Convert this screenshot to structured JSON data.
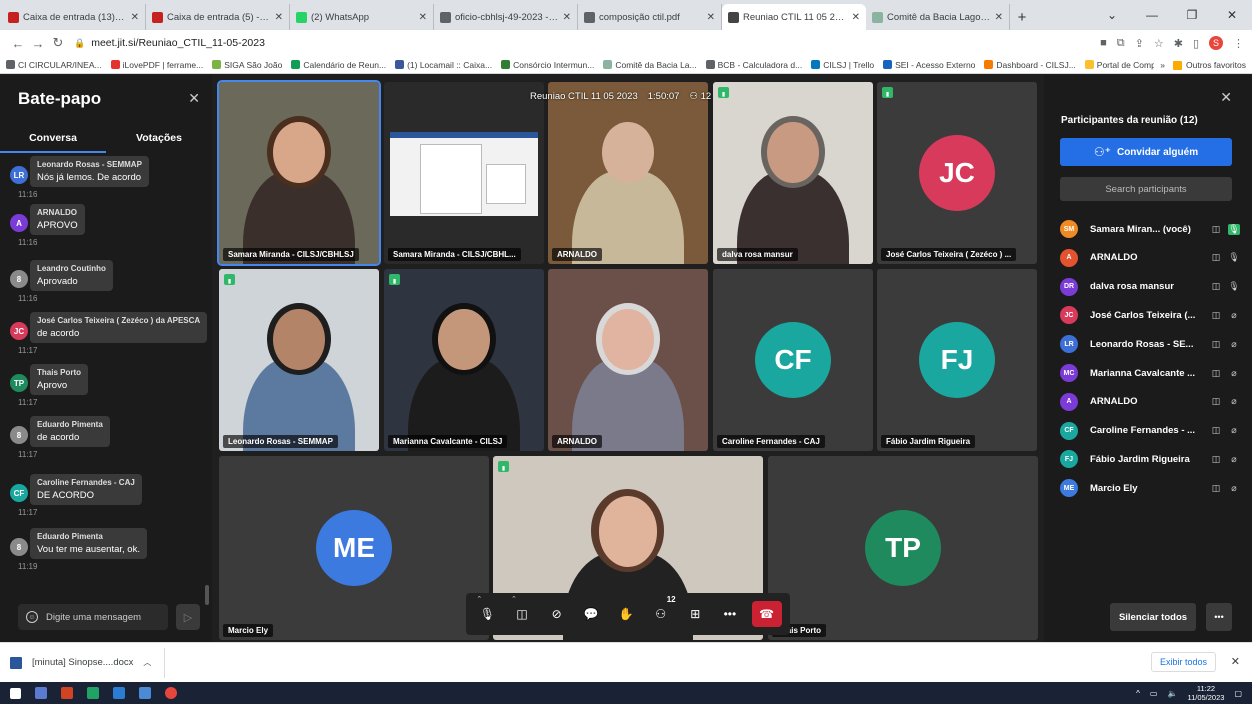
{
  "browser": {
    "tabs": [
      {
        "title": "Caixa de entrada (13) - samaran",
        "color": "#c5221f"
      },
      {
        "title": "Caixa de entrada (5) - cbhlagos",
        "color": "#c5221f"
      },
      {
        "title": "(2) WhatsApp",
        "color": "#25d366"
      },
      {
        "title": "oficio-cbhlsj-49-2023 - convocaç",
        "color": "#5f6368"
      },
      {
        "title": "composição ctil.pdf",
        "color": "#5f6368"
      },
      {
        "title": "Reuniao CTIL 11 05 2023 |",
        "color": "#444444",
        "active": true
      },
      {
        "title": "Comitê da Bacia Lagos São João",
        "color": "#8ab4a0"
      }
    ],
    "new_tab": "+",
    "url": "meet.jit.si/Reuniao_CTIL_11-05-2023",
    "bookmarks": [
      {
        "label": "CI CIRCULAR/INEA...",
        "color": "#5f6368"
      },
      {
        "label": "iLovePDF | ferrame...",
        "color": "#e5322d"
      },
      {
        "label": "SIGA São João",
        "color": "#7cb342"
      },
      {
        "label": "Calendário de Reun...",
        "color": "#0f9d58"
      },
      {
        "label": "(1) Locamail :: Caixa...",
        "color": "#3b5998"
      },
      {
        "label": "Consórcio Intermun...",
        "color": "#2e7d32"
      },
      {
        "label": "Comitê da Bacia La...",
        "color": "#8ab4a0"
      },
      {
        "label": "BCB - Calculadora d...",
        "color": "#5f6368"
      },
      {
        "label": "CILSJ | Trello",
        "color": "#0079bf"
      },
      {
        "label": "SEI - Acesso Externo",
        "color": "#1565c0"
      },
      {
        "label": "Dashboard - CILSJ...",
        "color": "#f57c00"
      },
      {
        "label": "Portal de Compras",
        "color": "#fbc02d"
      }
    ],
    "other_bookmarks": "Outros favoritos",
    "profile_initial": "S"
  },
  "chat": {
    "title": "Bate-papo",
    "tabs": [
      "Conversa",
      "Votações"
    ],
    "messages": [
      {
        "initials": "LR",
        "color": "#3d6fd6",
        "author": "Leonardo Rosas - SEMMAP",
        "text": "Nós já lemos. De acordo",
        "time": "11:16"
      },
      {
        "initials": "A",
        "color": "#7b3bd6",
        "author": "ARNALDO",
        "text": "APROVO",
        "time": "11:16"
      },
      {
        "initials": "8",
        "color": "#8a8a8a",
        "author": "Leandro Coutinho",
        "text": "Aprovado",
        "time": "11:16"
      },
      {
        "initials": "JC",
        "color": "#d83a5c",
        "author": "José Carlos Teixeira ( Zezéco ) da APESCA",
        "text": "de acordo",
        "time": "11:17"
      },
      {
        "initials": "TP",
        "color": "#1e8a5e",
        "author": "Thais Porto",
        "text": "Aprovo",
        "time": "11:17"
      },
      {
        "initials": "8",
        "color": "#8a8a8a",
        "author": "Eduardo Pimenta",
        "text": "de acordo",
        "time": "11:17"
      },
      {
        "initials": "CF",
        "color": "#1aa7a0",
        "author": "Caroline Fernandes - CAJ",
        "text": "DE ACORDO",
        "time": "11:17"
      },
      {
        "initials": "8",
        "color": "#8a8a8a",
        "author": "Eduardo Pimenta",
        "text": "Vou ter me ausentar, ok.",
        "time": "11:19"
      }
    ],
    "input_placeholder": "Digite uma mensagem"
  },
  "meeting": {
    "name": "Reuniao CTIL 11 05 2023",
    "elapsed": "1:50:07",
    "participant_count": "12",
    "tiles": [
      {
        "label": "Samara Miranda - CILSJ/CBHLSJ",
        "kind": "video"
      },
      {
        "label": "Samara Miranda - CILSJ/CBHL...",
        "kind": "screen"
      },
      {
        "label": "ARNALDO",
        "kind": "video"
      },
      {
        "label": "dalva rosa mansur",
        "kind": "video"
      },
      {
        "label": "José Carlos Teixeira ( Zezéco ) ...",
        "kind": "avatar",
        "initials": "JC",
        "color": "#d83a5c"
      },
      {
        "label": "Leonardo Rosas - SEMMAP",
        "kind": "video"
      },
      {
        "label": "Marianna Cavalcante - CILSJ",
        "kind": "video"
      },
      {
        "label": "ARNALDO",
        "kind": "video"
      },
      {
        "label": "Caroline Fernandes - CAJ",
        "kind": "avatar",
        "initials": "CF",
        "color": "#1aa7a0"
      },
      {
        "label": "Fábio Jardim Rigueira",
        "kind": "avatar",
        "initials": "FJ",
        "color": "#1aa7a0"
      },
      {
        "label": "Marcio Ely",
        "kind": "avatar",
        "initials": "ME",
        "color": "#3d7ae0"
      },
      {
        "label": "",
        "kind": "video"
      },
      {
        "label": "Thais Porto",
        "kind": "avatar",
        "initials": "TP",
        "color": "#1e8a5e"
      }
    ],
    "toolbar_count": "12"
  },
  "participants": {
    "title": "Participantes da reunião (12)",
    "invite_label": "Convidar alguém",
    "search_placeholder": "Search participants",
    "list": [
      {
        "initials": "SM",
        "color": "#f08a24",
        "name": "Samara Miran...",
        "suffix": "(você)"
      },
      {
        "initials": "A",
        "color": "#e4532f",
        "name": "ARNALDO",
        "suffix": ""
      },
      {
        "initials": "DR",
        "color": "#7b3bd6",
        "name": "dalva rosa mansur",
        "suffix": ""
      },
      {
        "initials": "JC",
        "color": "#d83a5c",
        "name": "José Carlos Teixeira (...",
        "suffix": ""
      },
      {
        "initials": "LR",
        "color": "#3d6fd6",
        "name": "Leonardo Rosas - SE...",
        "suffix": ""
      },
      {
        "initials": "MC",
        "color": "#7b3bd6",
        "name": "Marianna Cavalcante ...",
        "suffix": ""
      },
      {
        "initials": "A",
        "color": "#7b3bd6",
        "name": "ARNALDO",
        "suffix": ""
      },
      {
        "initials": "CF",
        "color": "#1aa7a0",
        "name": "Caroline Fernandes - ...",
        "suffix": ""
      },
      {
        "initials": "FJ",
        "color": "#1aa7a0",
        "name": "Fábio Jardim Rigueira",
        "suffix": ""
      },
      {
        "initials": "ME",
        "color": "#3d7ae0",
        "name": "Marcio Ely",
        "suffix": ""
      }
    ],
    "mute_all_label": "Silenciar todos"
  },
  "downloads": {
    "file": "[minuta] Sinopse....docx",
    "show_all": "Exibir todos"
  },
  "taskbar": {
    "time": "11:22",
    "date": "11/05/2023"
  }
}
